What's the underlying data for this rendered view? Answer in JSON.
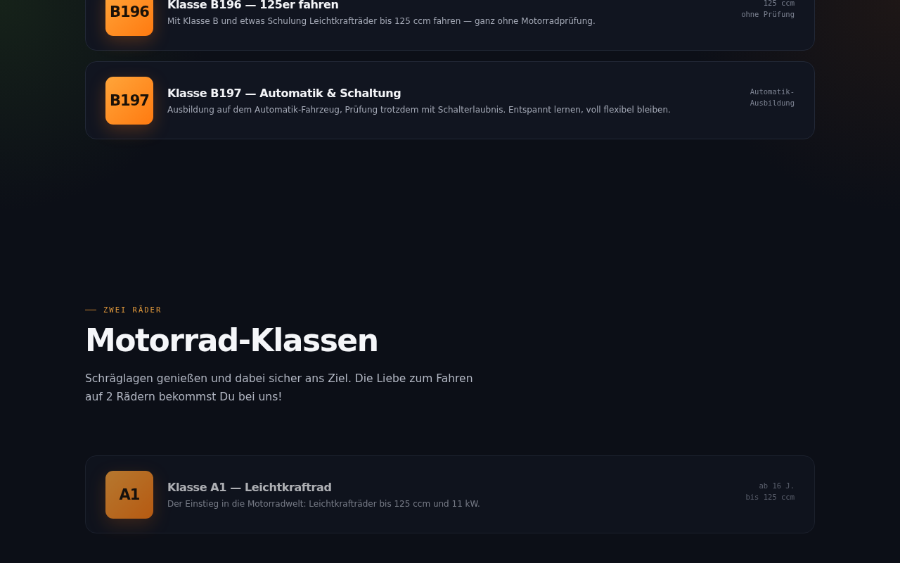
{
  "top_cards": [
    {
      "badge": "B196",
      "title": "Klasse B196 — 125er fahren",
      "description": "Mit Klasse B und etwas Schulung Leichtkrafträder bis 125 ccm fahren — ganz ohne Motorradprüfung.",
      "meta": [
        "125 ccm",
        "ohne Prüfung"
      ],
      "dimmed": false
    },
    {
      "badge": "B197",
      "title": "Klasse B197 — Automatik & Schaltung",
      "description": "Ausbildung auf dem Automatik-Fahrzeug, Prüfung trotzdem mit Schalterlaubnis. Entspannt lernen, voll flexibel bleiben.",
      "meta": [
        "Automatik-",
        "Ausbildung"
      ],
      "dimmed": false
    }
  ],
  "section": {
    "eyebrow": "ZWEI RÄDER",
    "heading": "Motorrad-Klassen",
    "intro": "Schräglagen genießen und dabei sicher ans Ziel. Die Liebe zum Fahren auf 2 Rädern bekommst Du bei uns!",
    "cards": [
      {
        "badge": "A1",
        "title": "Klasse A1 — Leichtkraftrad",
        "description": "Der Einstieg in die Motorradwelt: Leichtkrafträder bis 125 ccm und 11 kW.",
        "meta": [
          "ab 16 J.",
          "bis 125 ccm"
        ],
        "dimmed": true
      }
    ]
  }
}
